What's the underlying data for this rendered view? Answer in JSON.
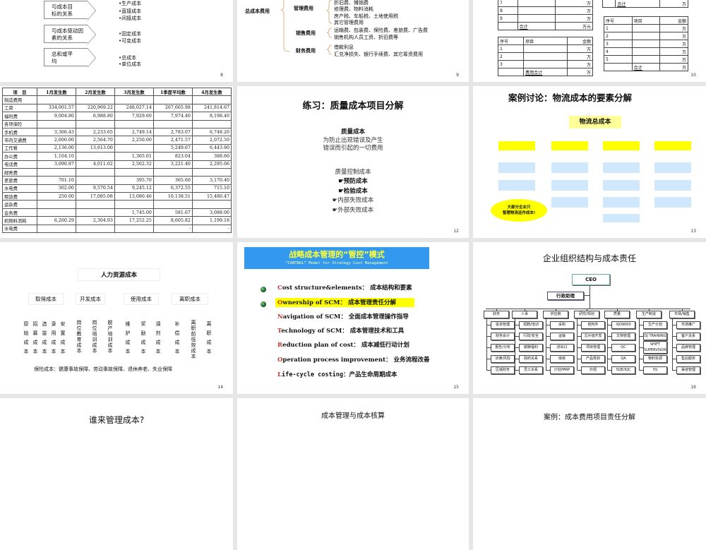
{
  "slides": {
    "s8": {
      "page": "8",
      "top_bullet": "•生产成本",
      "boxes": [
        {
          "label_line1": "与成本目",
          "label_line2": "标的关系",
          "bullets": [
            "•直接成本",
            "•间接成本"
          ]
        },
        {
          "label_line1": "与成本驱动因",
          "label_line2": "素的关系",
          "bullets": [
            "•固定成本",
            "•可变成本"
          ]
        },
        {
          "label_line1": "总和或平",
          "label_line2": "均",
          "bullets": [
            "•总成本",
            "•单位成本"
          ]
        }
      ]
    },
    "s9": {
      "page": "9",
      "root": "总成本费用",
      "groups": [
        {
          "name": "管理费用",
          "items": [
            "折旧费、摊销费",
            "修理费、物料消耗",
            "房产税、车船税、土地使用税",
            "其它管理费用"
          ]
        },
        {
          "name": "销售费用",
          "items": [
            "运输费、包装费、保险费、差旅费、广告费",
            "销售机构人员工资、折旧费等"
          ]
        },
        {
          "name": "财务费用",
          "items": [
            "借款利息",
            "汇兑净损失、银行手续费、其它筹资费用"
          ]
        }
      ]
    },
    "s10": {
      "page": "10",
      "table_a": [
        [
          "7",
          "",
          "万"
        ],
        [
          "8",
          "",
          "万"
        ],
        [
          "9",
          "",
          "万"
        ],
        [
          "",
          "合计",
          "万元"
        ]
      ],
      "table_b": [
        [
          "序号",
          "项目",
          "金额"
        ],
        [
          "1",
          "",
          "万"
        ],
        [
          "2",
          "",
          "万"
        ],
        [
          "3",
          "",
          "万"
        ],
        [
          "",
          "费用合计",
          "万"
        ]
      ],
      "table_c": [
        [
          "",
          "合计",
          "万"
        ]
      ],
      "table_d": [
        [
          "序号",
          "项目",
          "金额"
        ],
        [
          "1",
          "",
          "万"
        ],
        [
          "2",
          "",
          "万"
        ],
        [
          "3",
          "",
          "万"
        ],
        [
          "4",
          "",
          "万"
        ],
        [
          "5",
          "",
          "万"
        ],
        [
          "",
          "合计",
          "万"
        ]
      ]
    },
    "s11": {
      "page": "11",
      "table": [
        [
          "项　目",
          "1月发生数",
          "2月发生数",
          "3月发生数",
          "1季度平均数",
          "4月发生数"
        ],
        [
          "制造费用",
          "",
          "",
          "",
          "",
          ""
        ],
        [
          "工资",
          "334,001.57",
          "220,969.22",
          "248,027.14",
          "267,665.98",
          "241,814.67"
        ],
        [
          "福利费",
          "9,004.80",
          "6,988.80",
          "7,929.60",
          "7,974.40",
          "8,198.40"
        ],
        [
          "各项保险",
          "",
          "",
          "",
          "",
          ""
        ],
        [
          "手机费",
          "3,366.43",
          "2,233.65",
          "2,749.14",
          "2,783.07",
          "6,748.20"
        ],
        [
          "市内交通费",
          "2,600.00",
          "2,564.70",
          "2,250.00",
          "2,471.57",
          "2,072.50"
        ],
        [
          "工作餐",
          "2,136.00",
          "13,613.00",
          "",
          "5,249.67",
          "6,443.90"
        ],
        [
          "办公费",
          "1,104.10",
          "",
          "1,365.01",
          "823.04",
          "388.60"
        ],
        [
          "电话费",
          "3,090.87",
          "4,011.02",
          "2,562.32",
          "3,221.40",
          "2,295.06"
        ],
        [
          "邮寄费",
          "",
          "",
          "",
          "",
          ""
        ],
        [
          "差旅费",
          "701.10",
          "",
          "395.70",
          "365.60",
          "3,170.40"
        ],
        [
          "水电费",
          "302.00",
          "9,570.54",
          "9,245.12",
          "6,372.55",
          "715.10"
        ],
        [
          "租赁费",
          "250.00",
          "17,085.08",
          "13,080.46",
          "10,138.51",
          "15,480.47"
        ],
        [
          " 运杂费",
          "",
          "",
          "",
          "",
          ""
        ],
        [
          "会务费",
          "",
          "",
          "1,745.00",
          "581.67",
          "3,088.00"
        ],
        [
          "机物料消耗",
          "6,260.29",
          "2,304.93",
          "17,252.25",
          "8,605.82",
          "1,199.18"
        ],
        [
          "水电费",
          "",
          "",
          "",
          "-",
          "-"
        ]
      ]
    },
    "s12": {
      "page": "12",
      "title": "练习：质量成本项目分解",
      "heading": "质量成本",
      "desc1": "为防止出现错误及产生",
      "desc2": "错误而引起的一切费用",
      "sub": "质量控制成本",
      "items": [
        "☛预防成本",
        "☛检验成本",
        "☛内部失败成本",
        "☛外部失败成本"
      ]
    },
    "s13": {
      "page": "13",
      "title": "案例讨论：物流成本的要素分解",
      "root": "物流总成本",
      "callout1": "大部分企业只",
      "callout2": "管理物流运作成本!",
      "colors": {
        "yellow": "#ffff00",
        "blue": "#cfe8fb"
      }
    },
    "s14": {
      "page": "14",
      "title": "人力资源成本",
      "categories": [
        {
          "name": "取得成本",
          "items": [
            "原始成本",
            "招募成本",
            "选拔成本",
            "录用成本",
            "安置成本"
          ]
        },
        {
          "name": "开发成本",
          "items": [
            "岗位教育成本",
            "岗位培训成本",
            "脱产培训成本"
          ]
        },
        {
          "name": "使用成本",
          "items": [
            "维护成本",
            "奖励成本",
            "调剂成本"
          ]
        },
        {
          "name": "离职成本",
          "items": [
            "补偿成本",
            "离职前低效成本",
            "离职成本"
          ]
        }
      ],
      "footer": "保险成本：健康事故保障、劳动事故保障、退休养老、失业保障"
    },
    "s15": {
      "page": "15",
      "title": "战略成本管理的“管控”模式",
      "subtitle": "“CONTROL” Model  for Strategy Cost Management",
      "lines": [
        {
          "initial": "C",
          "rest": "ost structure&elements： 成本结构和要素"
        },
        {
          "initial": "O",
          "rest": "wnership of SCM： 成本管理责任分解"
        },
        {
          "initial": "N",
          "rest": "avigation of SCM： 全面成本管理操作指导"
        },
        {
          "initial": "T",
          "rest": "echnology of SCM： 成本管理技术和工具"
        },
        {
          "initial": "R",
          "rest": "eduction plan of cost： 成本减低行动计划"
        },
        {
          "initial": "O",
          "rest": "peration process improvement： 业务流程改善"
        },
        {
          "initial": "L",
          "rest": "ife-cycle costing：产品生命周期成本"
        }
      ]
    },
    "s16": {
      "page": "16",
      "title": "企业组织结构与成本责任",
      "ceo": "CEO",
      "assistant": "行政助理",
      "departments": [
        {
          "name": "财务",
          "items": [
            "投资管理",
            "财务会计",
            "报告/分析",
            "法律/风险",
            "区域财务"
          ]
        },
        {
          "name": "人事",
          "items": [
            "招聘/培训",
            "行政/安全",
            "薪酬福利",
            "政府关系",
            "员工关系"
          ]
        },
        {
          "name": "供应链",
          "items": [
            "采购",
            "运输",
            "进出口",
            "库房",
            "计划/MRP"
          ]
        },
        {
          "name": "研究/规划",
          "items": [
            "结构件",
            "芯片级开发",
            "项目管理",
            "产品规划",
            "外观"
          ]
        },
        {
          "name": "质量",
          "items": [
            "ISO9000",
            "文档管理",
            "QC",
            "QA",
            "SQE/IQC"
          ]
        },
        {
          "name": "生产制造",
          "items": [
            "生产计划",
            "OJ TRAINING",
            "SHIFT SUPERVISOR",
            "物料协调",
            "5S"
          ]
        },
        {
          "name": "市场/销售",
          "items": [
            "市场推广",
            "客户关系",
            "品牌管理",
            "售后服务",
            "渠道管理"
          ]
        }
      ]
    },
    "s17": {
      "title": "谁来管理成本?"
    },
    "s18": {
      "title": "成本管理与成本核算"
    },
    "s19": {
      "title": "案例：成本费用项目责任分解"
    }
  }
}
